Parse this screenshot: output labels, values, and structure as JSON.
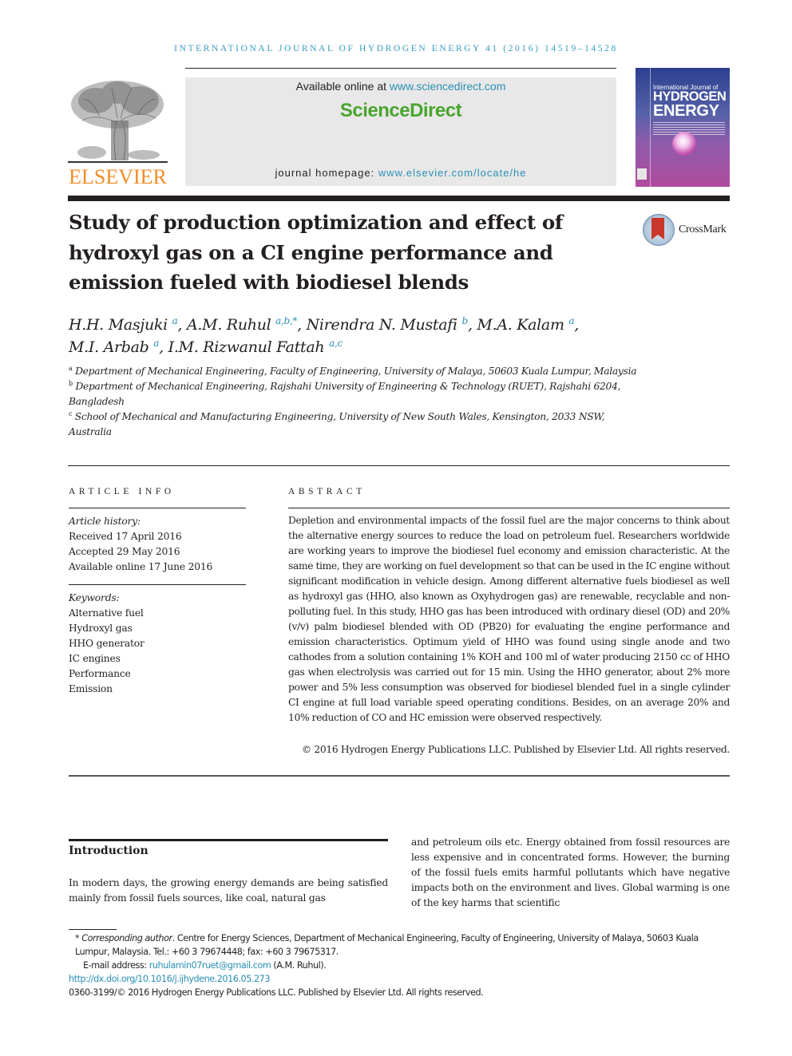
{
  "running_head": "International Journal of Hydrogen Energy 41 (2016) 14519–14528",
  "publisher": {
    "logo_word": "ELSEVIER",
    "available_prefix": "Available online at ",
    "available_link": "www.sciencedirect.com",
    "brand": "ScienceDirect",
    "homepage_prefix": "journal homepage: ",
    "homepage_link": "www.elsevier.com/locate/he",
    "colors": {
      "elsevier_orange": "#f28c28",
      "sciencedirect_green": "#4aa52e",
      "link_blue": "#2a8fb5"
    }
  },
  "journal_cover": {
    "line1": "International Journal of",
    "line2": "HYDROGEN",
    "line3": "ENERGY"
  },
  "crossmark": {
    "label": "CrossMark"
  },
  "article": {
    "title": "Study of production optimization and effect of hydroxyl gas on a CI engine performance and emission fueled with biodiesel blends",
    "authors": [
      {
        "name": "H.H. Masjuki",
        "aff": "a",
        "sep": ", "
      },
      {
        "name": "A.M. Ruhul",
        "aff": "a,b,*",
        "sep": ", "
      },
      {
        "name": "Nirendra N. Mustafi",
        "aff": "b",
        "sep": ", "
      },
      {
        "name": "M.A. Kalam",
        "aff": "a",
        "sep": ","
      },
      {
        "name": "M.I. Arbab",
        "aff": "a",
        "sep": ", "
      },
      {
        "name": "I.M. Rizwanul Fattah",
        "aff": "a,c",
        "sep": ""
      }
    ],
    "affiliations": [
      {
        "mark": "a",
        "text": "Department of Mechanical Engineering, Faculty of Engineering, University of Malaya, 50603 Kuala Lumpur, Malaysia"
      },
      {
        "mark": "b",
        "text": "Department of Mechanical Engineering, Rajshahi University of Engineering & Technology (RUET), Rajshahi 6204, Bangladesh"
      },
      {
        "mark": "c",
        "text": "School of Mechanical and Manufacturing Engineering, University of New South Wales, Kensington, 2033 NSW, Australia"
      }
    ]
  },
  "article_info": {
    "label": "ARTICLE INFO",
    "history_label": "Article history:",
    "history": [
      "Received 17 April 2016",
      "Accepted 29 May 2016",
      "Available online 17 June 2016"
    ],
    "keywords_label": "Keywords:",
    "keywords": [
      "Alternative fuel",
      "Hydroxyl gas",
      "HHO generator",
      "IC engines",
      "Performance",
      "Emission"
    ]
  },
  "abstract": {
    "label": "ABSTRACT",
    "text": "Depletion and environmental impacts of the fossil fuel are the major concerns to think about the alternative energy sources to reduce the load on petroleum fuel. Researchers worldwide are working years to improve the biodiesel fuel economy and emission characteristic. At the same time, they are working on fuel development so that can be used in the IC engine without significant modification in vehicle design. Among different alternative fuels biodiesel as well as hydroxyl gas (HHO, also known as Oxyhydrogen gas) are renewable, recyclable and non-polluting fuel. In this study, HHO gas has been introduced with ordinary diesel (OD) and 20% (v/v) palm biodiesel blended with OD (PB20) for evaluating the engine performance and emission characteristics. Optimum yield of HHO was found using single anode and two cathodes from a solution containing 1% KOH and 100 ml of water producing 2150 cc of HHO gas when electrolysis was carried out for 15 min. Using the HHO generator, about 2% more power and 5% less consumption was observed for biodiesel blended fuel in a single cylinder CI engine at full load variable speed operating conditions. Besides, on an average 20% and 10% reduction of CO and HC emission were observed respectively.",
    "copyright": "© 2016 Hydrogen Energy Publications LLC. Published by Elsevier Ltd. All rights reserved."
  },
  "introduction": {
    "heading": "Introduction",
    "col1": "In modern days, the growing energy demands are being satisfied mainly from fossil fuels sources, like coal, natural gas",
    "col2": "and petroleum oils etc. Energy obtained from fossil resources are less expensive and in concentrated forms. However, the burning of the fossil fuels emits harmful pollutants which have negative impacts both on the environment and lives. Global warming is one of the key harms that scientific"
  },
  "footnotes": {
    "corresponding_mark": "* ",
    "corresponding_label": "Corresponding author",
    "corresponding_text": ". Centre for Energy Sciences, Department of Mechanical Engineering, Faculty of Engineering, University of Malaya, 50603 Kuala Lumpur, Malaysia. Tel.: +60 3 79674448; fax: +60 3 79675317.",
    "email_label": "E-mail address: ",
    "email": "ruhulamin07ruet@gmail.com",
    "email_suffix": " (A.M. Ruhul).",
    "doi": "http://dx.doi.org/10.1016/j.ijhydene.2016.05.273",
    "issn_line": "0360-3199/© 2016 Hydrogen Energy Publications LLC. Published by Elsevier Ltd. All rights reserved."
  }
}
